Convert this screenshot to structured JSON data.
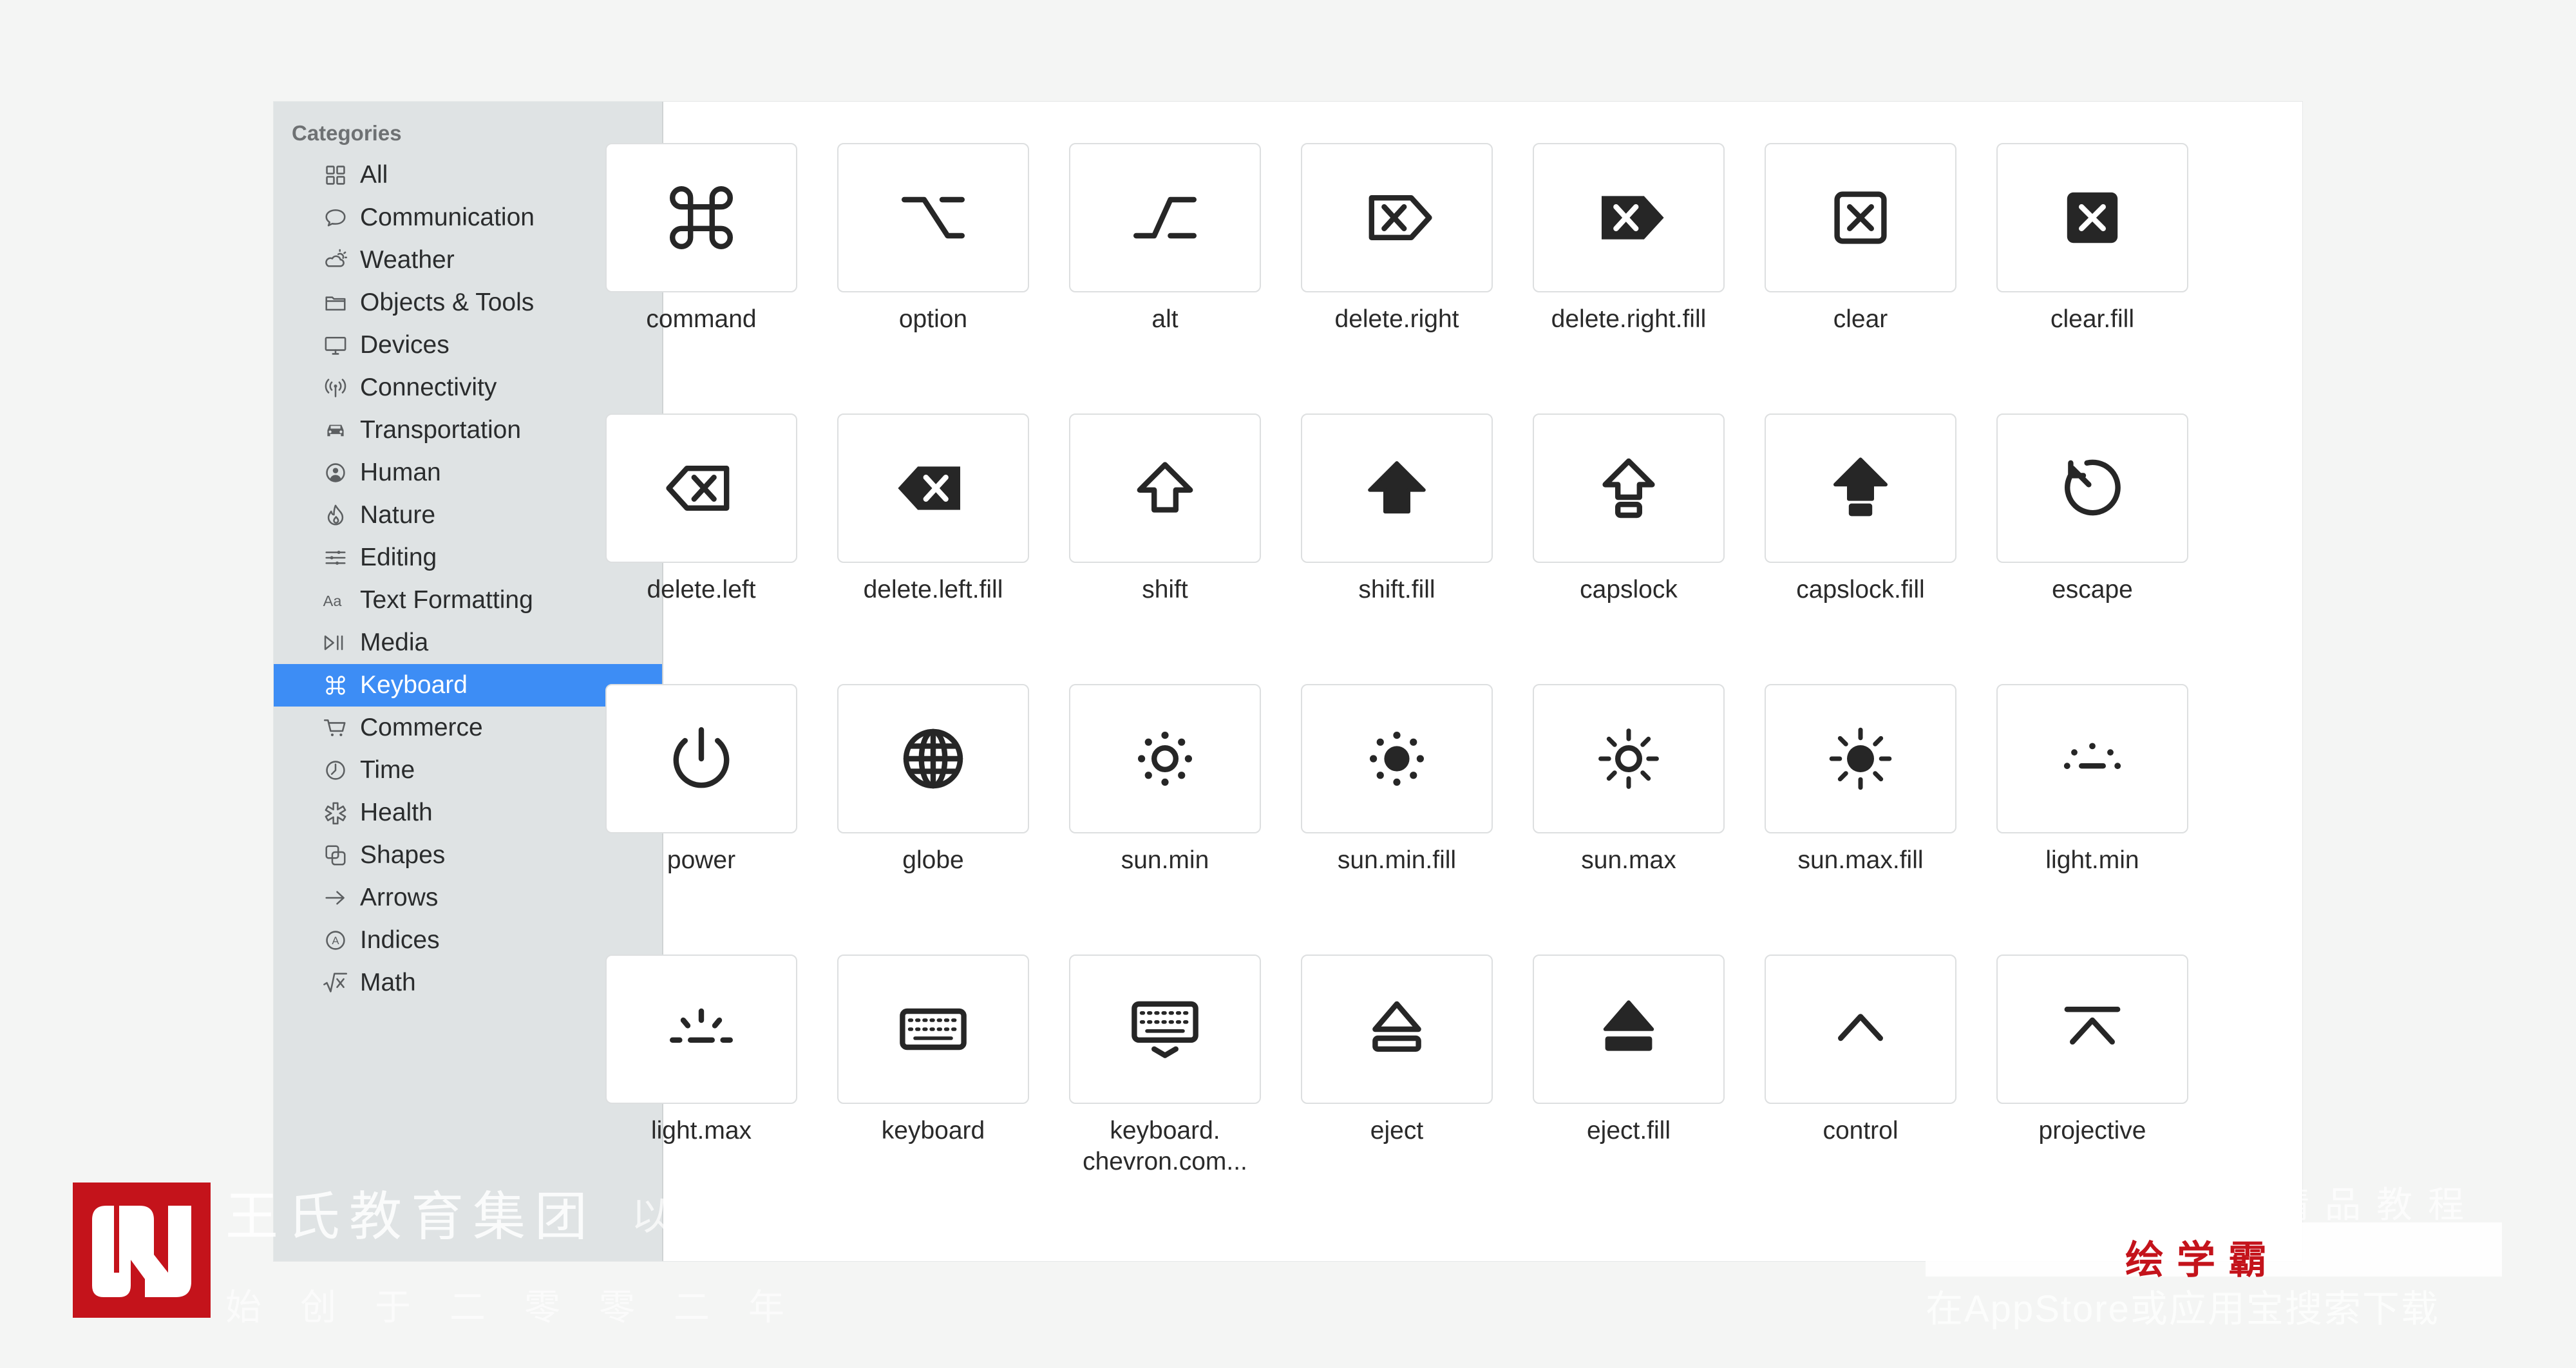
{
  "sidebar": {
    "heading": "Categories",
    "items": [
      {
        "label": "All",
        "icon": "grid-icon"
      },
      {
        "label": "Communication",
        "icon": "speech-bubble-icon"
      },
      {
        "label": "Weather",
        "icon": "cloud-sun-icon"
      },
      {
        "label": "Objects & Tools",
        "icon": "folder-icon"
      },
      {
        "label": "Devices",
        "icon": "display-icon"
      },
      {
        "label": "Connectivity",
        "icon": "antenna-icon"
      },
      {
        "label": "Transportation",
        "icon": "car-icon"
      },
      {
        "label": "Human",
        "icon": "person-circle-icon"
      },
      {
        "label": "Nature",
        "icon": "flame-icon"
      },
      {
        "label": "Editing",
        "icon": "sliders-icon"
      },
      {
        "label": "Text Formatting",
        "icon": "text-aa-icon"
      },
      {
        "label": "Media",
        "icon": "play-pause-icon"
      },
      {
        "label": "Keyboard",
        "icon": "command-icon",
        "selected": true
      },
      {
        "label": "Commerce",
        "icon": "cart-icon"
      },
      {
        "label": "Time",
        "icon": "clock-icon"
      },
      {
        "label": "Health",
        "icon": "staroflife-icon"
      },
      {
        "label": "Shapes",
        "icon": "shapes-icon"
      },
      {
        "label": "Arrows",
        "icon": "arrow-right-icon"
      },
      {
        "label": "Indices",
        "icon": "circle-a-icon"
      },
      {
        "label": "Math",
        "icon": "square-root-icon"
      }
    ]
  },
  "symbols": [
    {
      "name": "command",
      "icon": "command-icon"
    },
    {
      "name": "option",
      "icon": "option-icon"
    },
    {
      "name": "alt",
      "icon": "alt-icon"
    },
    {
      "name": "delete.right",
      "icon": "delete-right-icon"
    },
    {
      "name": "delete.right.fill",
      "icon": "delete-right-fill-icon"
    },
    {
      "name": "clear",
      "icon": "clear-icon"
    },
    {
      "name": "clear.fill",
      "icon": "clear-fill-icon"
    },
    {
      "name": "delete.left",
      "icon": "delete-left-icon"
    },
    {
      "name": "delete.left.fill",
      "icon": "delete-left-fill-icon"
    },
    {
      "name": "shift",
      "icon": "shift-icon"
    },
    {
      "name": "shift.fill",
      "icon": "shift-fill-icon"
    },
    {
      "name": "capslock",
      "icon": "capslock-icon"
    },
    {
      "name": "capslock.fill",
      "icon": "capslock-fill-icon"
    },
    {
      "name": "escape",
      "icon": "escape-icon"
    },
    {
      "name": "power",
      "icon": "power-icon"
    },
    {
      "name": "globe",
      "icon": "globe-icon"
    },
    {
      "name": "sun.min",
      "icon": "sun-min-icon"
    },
    {
      "name": "sun.min.fill",
      "icon": "sun-min-fill-icon"
    },
    {
      "name": "sun.max",
      "icon": "sun-max-icon"
    },
    {
      "name": "sun.max.fill",
      "icon": "sun-max-fill-icon"
    },
    {
      "name": "light.min",
      "icon": "light-min-icon"
    },
    {
      "name": "light.max",
      "icon": "light-max-icon"
    },
    {
      "name": "keyboard",
      "icon": "keyboard-icon"
    },
    {
      "name": "keyboard.\nchevron.com...",
      "icon": "keyboard-chevron-icon"
    },
    {
      "name": "eject",
      "icon": "eject-icon"
    },
    {
      "name": "eject.fill",
      "icon": "eject-fill-icon"
    },
    {
      "name": "control",
      "icon": "control-icon"
    },
    {
      "name": "projective",
      "icon": "projective-icon"
    }
  ],
  "watermark": {
    "group": "王氏教育集团",
    "slogan_left": "以",
    "founded": "始创于二零零二年",
    "slogan_right": "精品教程",
    "app_name": "绘学霸",
    "download": "在AppStore或应用宝搜索下载"
  }
}
